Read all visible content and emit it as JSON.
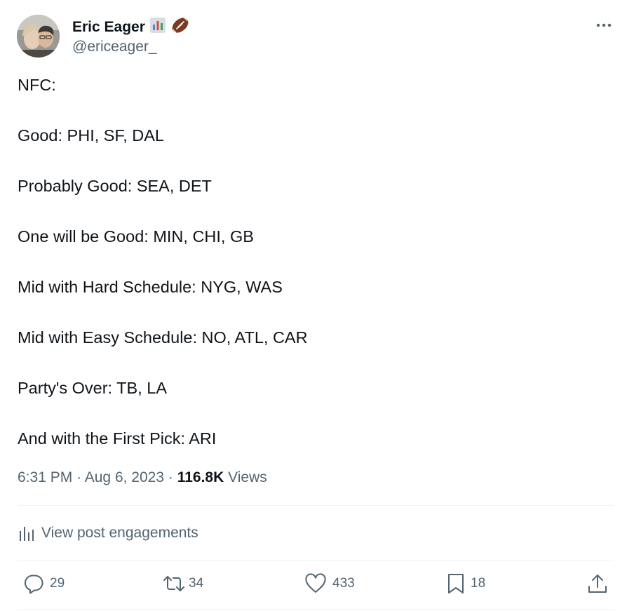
{
  "author": {
    "display_name": "Eric Eager",
    "handle": "@ericeager_",
    "name_emojis": [
      "bar-chart-emoji",
      "football-emoji"
    ]
  },
  "tweet": {
    "lines": [
      "NFC:",
      "Good: PHI, SF, DAL",
      "Probably Good: SEA, DET",
      "One will be Good: MIN, CHI, GB",
      "Mid with Hard Schedule: NYG, WAS",
      "Mid with Easy Schedule: NO, ATL, CAR",
      "Party's Over: TB, LA",
      "And with the First Pick: ARI"
    ]
  },
  "meta": {
    "time": "6:31 PM",
    "separator": "·",
    "date": "Aug 6, 2023",
    "views_count": "116.8K",
    "views_label": "Views"
  },
  "engagements": {
    "label": "View post engagements"
  },
  "actions": {
    "replies": "29",
    "reposts": "34",
    "likes": "433",
    "bookmarks": "18"
  },
  "colors": {
    "text_primary": "#0f1419",
    "text_secondary": "#536471",
    "divider": "#eff3f4",
    "background": "#ffffff"
  }
}
